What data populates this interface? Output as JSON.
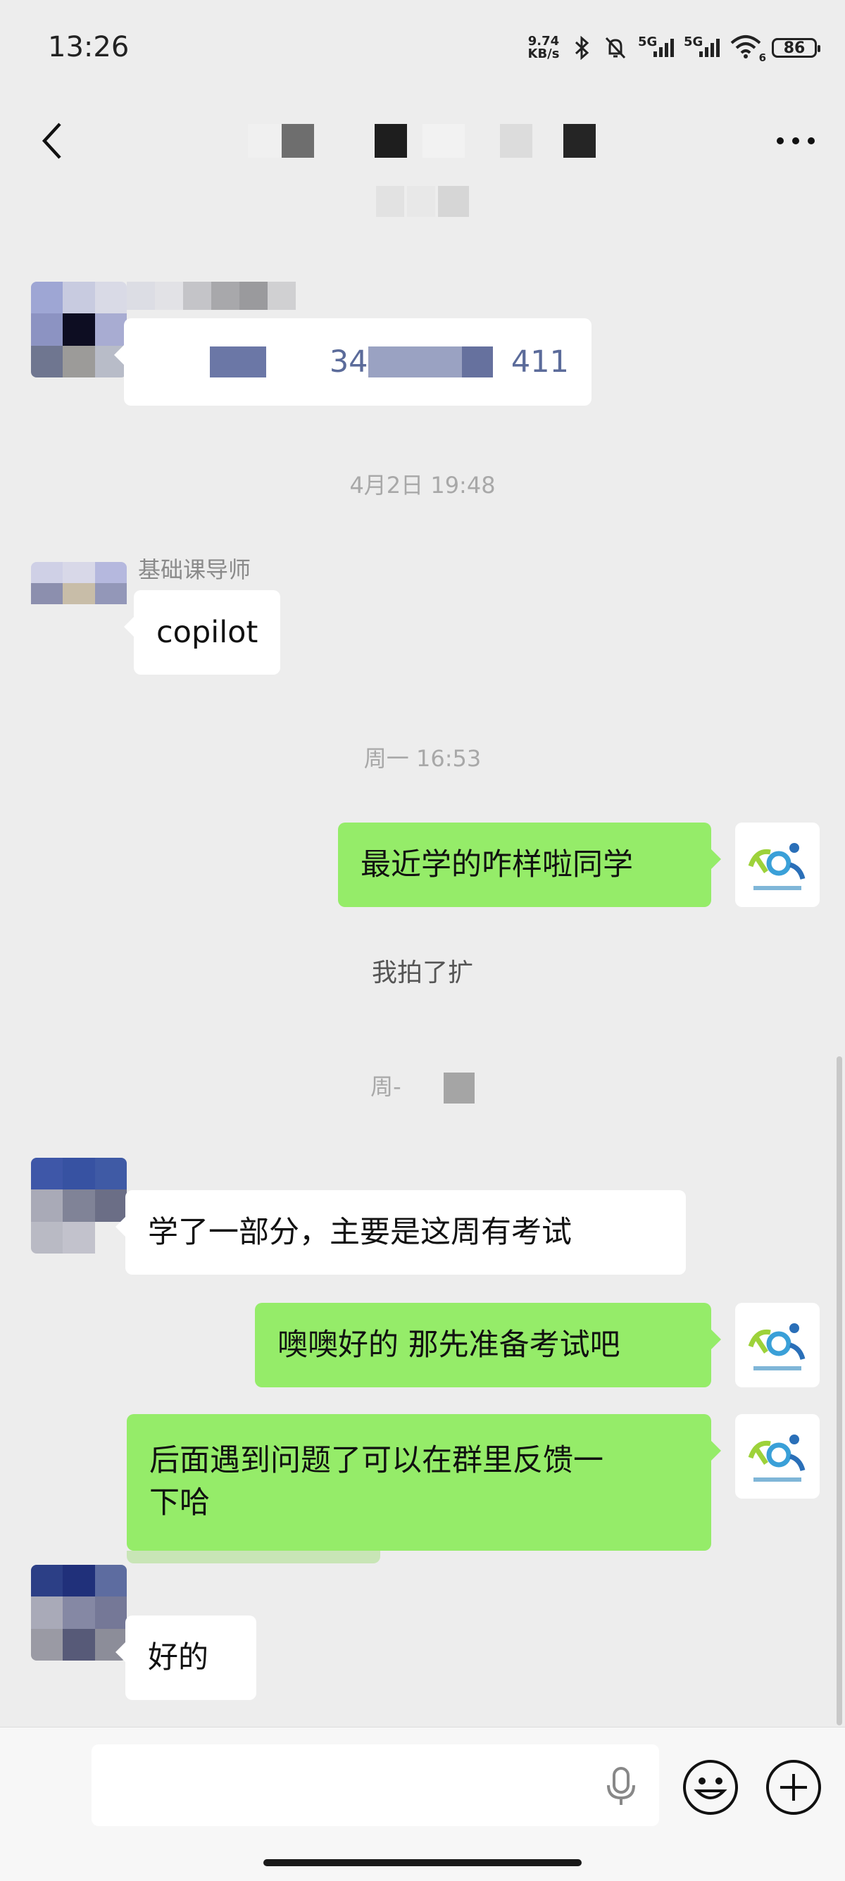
{
  "status_bar": {
    "time": "13:26",
    "net_speed_value": "9.74",
    "net_speed_unit": "KB/s",
    "sim1_label": "5G",
    "sim2_label": "5G",
    "wifi_label": "6",
    "battery": "86",
    "icons": [
      "bluetooth-icon",
      "mute-bell-icon",
      "signal-icon",
      "wifi-icon",
      "battery-icon"
    ]
  },
  "header": {
    "back_icon": "chevron-left-icon",
    "more_icon": "more-dots-icon"
  },
  "messages": [
    {
      "id": "m1",
      "side": "in",
      "text_left": "",
      "text_mid": "34",
      "text_right": "411"
    },
    {
      "id": "ts1",
      "type": "timestamp",
      "text": "4月2日 19:48"
    },
    {
      "id": "m2",
      "side": "in",
      "sender": "基础课导师",
      "text": "copilot"
    },
    {
      "id": "ts2",
      "type": "timestamp",
      "text": "周一 16:53"
    },
    {
      "id": "m3",
      "side": "out",
      "text": "最近学的咋样啦同学"
    },
    {
      "id": "sys1",
      "type": "system",
      "text": "我拍了扩"
    },
    {
      "id": "ts3",
      "type": "timestamp",
      "text": "周-"
    },
    {
      "id": "m4",
      "side": "in",
      "text": "学了一部分，主要是这周有考试"
    },
    {
      "id": "m5",
      "side": "out",
      "text": "噢噢好的 那先准备考试吧"
    },
    {
      "id": "m6",
      "side": "out",
      "text_line1": "后面遇到问题了可以在群里反馈一",
      "text_line2": "下哈"
    },
    {
      "id": "m7",
      "side": "in",
      "text": "好的"
    }
  ],
  "input_bar": {
    "mic_icon": "microphone-icon",
    "emoji_icon": "emoji-icon",
    "plus_icon": "plus-circle-icon"
  },
  "colors": {
    "background": "#ededed",
    "outgoing_bubble": "#95ec69",
    "incoming_bubble": "#ffffff",
    "timestamp": "#a8a8a8"
  }
}
